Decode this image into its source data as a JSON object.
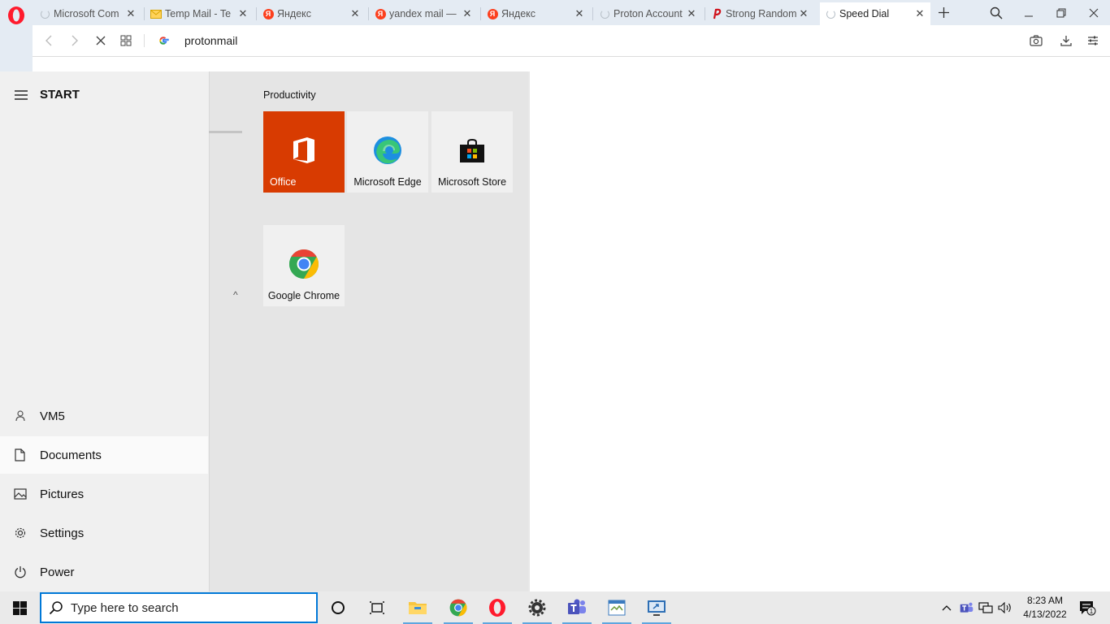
{
  "browser": {
    "tabs": [
      {
        "label": "Microsoft Com",
        "favicon": "loading-spinner",
        "active": false
      },
      {
        "label": "Temp Mail - Te",
        "favicon": "temp-mail-envelope",
        "active": false
      },
      {
        "label": "Яндекс",
        "favicon": "yandex-logo",
        "active": false
      },
      {
        "label": "yandex mail —",
        "favicon": "yandex-logo",
        "active": false
      },
      {
        "label": "Яндекс",
        "favicon": "yandex-logo",
        "active": false
      },
      {
        "label": "Proton Account",
        "favicon": "loading-spinner",
        "active": false
      },
      {
        "label": "Strong Random",
        "favicon": "strong-random-logo",
        "active": false
      },
      {
        "label": "Speed Dial",
        "favicon": "loading-spinner",
        "active": true
      }
    ],
    "address": "protonmail",
    "accent": "#e4ebf3"
  },
  "start_menu": {
    "title": "START",
    "group_title": "Productivity",
    "tiles": [
      {
        "label": "Office",
        "icon": "office-logo",
        "color": "#d83b01"
      },
      {
        "label": "Microsoft Edge",
        "icon": "edge-logo"
      },
      {
        "label": "Microsoft Store",
        "icon": "store-bag-icon"
      },
      {
        "label": "Google Chrome",
        "icon": "chrome-logo"
      }
    ],
    "side_items": [
      {
        "label": "VM5",
        "icon": "user-icon"
      },
      {
        "label": "Documents",
        "icon": "document-icon"
      },
      {
        "label": "Pictures",
        "icon": "pictures-icon"
      },
      {
        "label": "Settings",
        "icon": "gear-icon"
      },
      {
        "label": "Power",
        "icon": "power-icon"
      }
    ]
  },
  "taskbar": {
    "search_placeholder": "Type here to search",
    "clock_time": "8:23 AM",
    "clock_date": "4/13/2022",
    "notification_count": "1"
  }
}
